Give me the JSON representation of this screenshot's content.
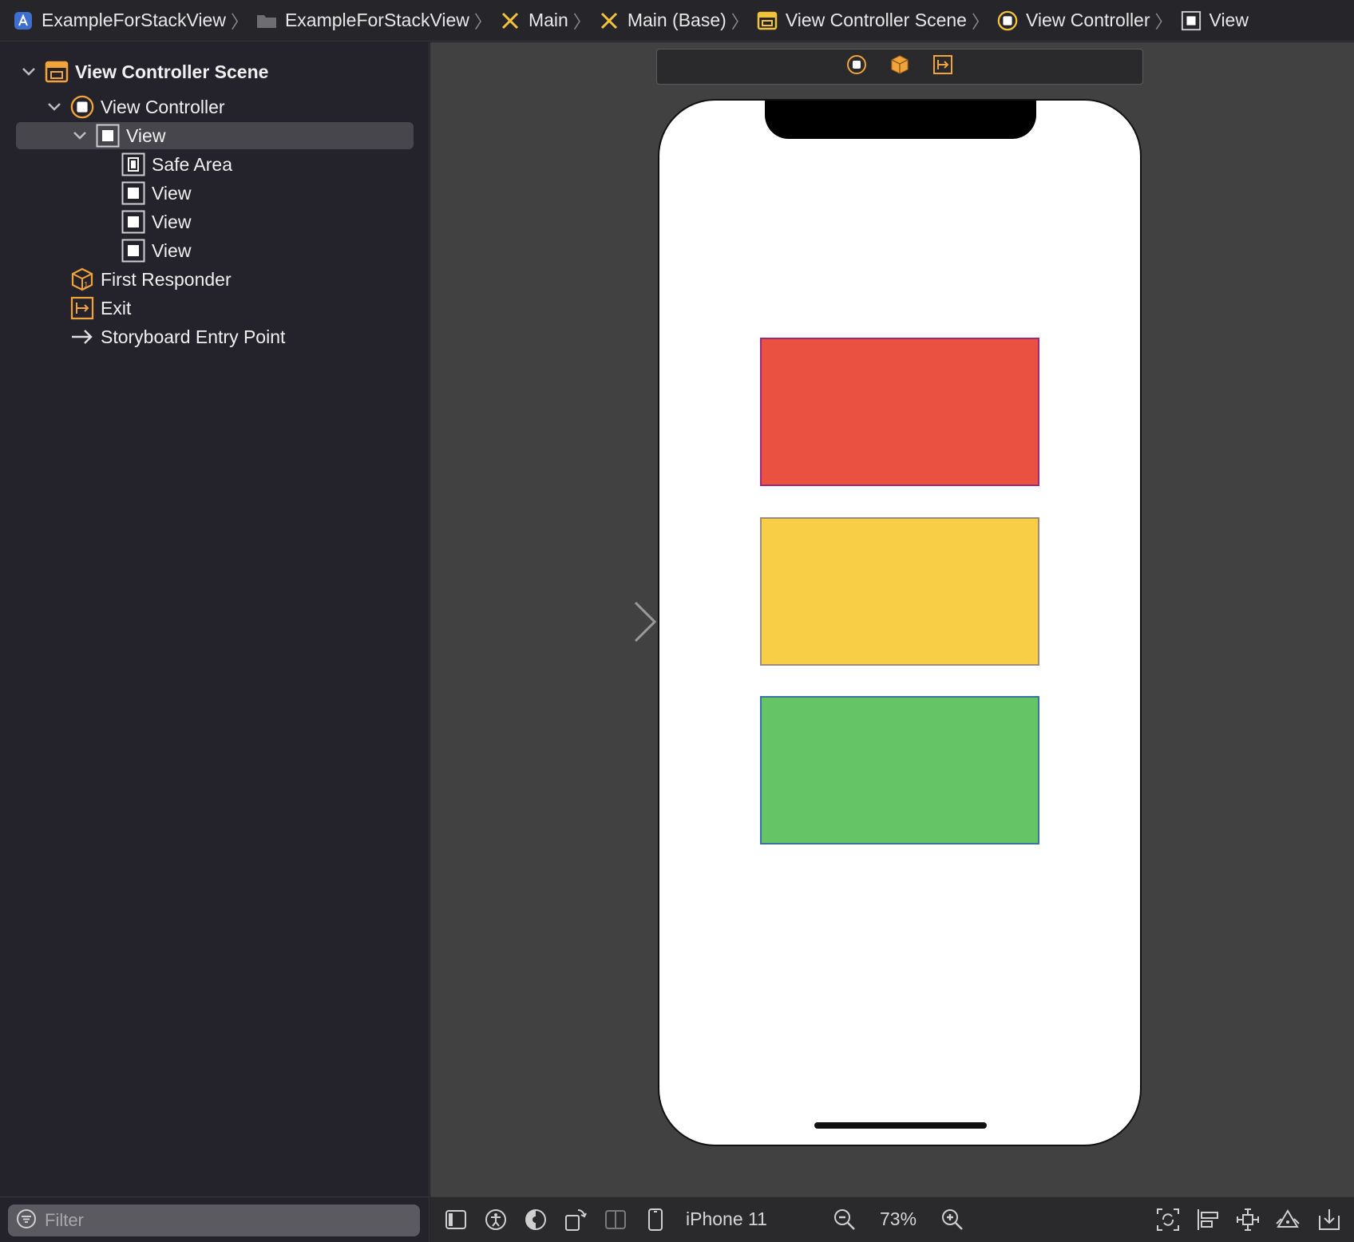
{
  "breadcrumb": [
    {
      "label": "ExampleForStackView",
      "icon": "app-project-icon"
    },
    {
      "label": "ExampleForStackView",
      "icon": "folder-icon"
    },
    {
      "label": "Main",
      "icon": "storyboard-icon"
    },
    {
      "label": "Main (Base)",
      "icon": "storyboard-icon"
    },
    {
      "label": "View Controller Scene",
      "icon": "scene-icon"
    },
    {
      "label": "View Controller",
      "icon": "view-controller-icon"
    },
    {
      "label": "View",
      "icon": "view-icon"
    }
  ],
  "outline": {
    "scene": "View Controller Scene",
    "view_controller": "View Controller",
    "root_view": "View",
    "safe_area": "Safe Area",
    "subviews": [
      "View",
      "View",
      "View"
    ],
    "first_responder": "First Responder",
    "exit": "Exit",
    "entry_point": "Storyboard Entry Point"
  },
  "filter": {
    "placeholder": "Filter"
  },
  "canvas": {
    "views": [
      {
        "name": "red",
        "color": "#EA5140"
      },
      {
        "name": "yellow",
        "color": "#F7CE46"
      },
      {
        "name": "green",
        "color": "#65C466"
      }
    ]
  },
  "toolbar": {
    "device": "iPhone 11",
    "zoom": "73%"
  },
  "colors": {
    "accent_orange": "#F2A33A",
    "selection": "#46464C",
    "canvas_bg": "#414141"
  }
}
